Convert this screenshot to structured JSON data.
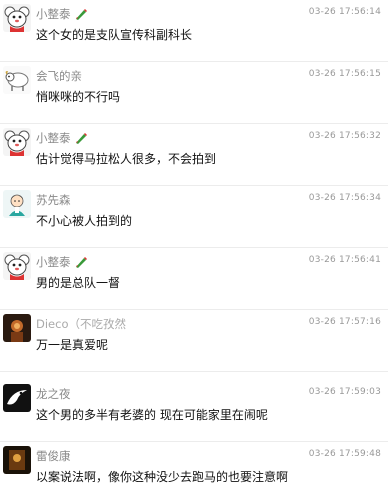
{
  "comments": [
    {
      "user": "小整泰",
      "time": "03-26 17:56:14",
      "text": "这个女的是支队宣传科副科长",
      "avatar": "cartoon-mouse",
      "badge": "pencil-icon"
    },
    {
      "user": "会飞的亲",
      "time": "03-26 17:56:15",
      "text": "悄咪咪的不行吗",
      "avatar": "cartoon-sheep"
    },
    {
      "user": "小整泰",
      "time": "03-26 17:56:32",
      "text": "估计觉得马拉松人很多，不会拍到",
      "avatar": "cartoon-mouse",
      "badge": "pencil-icon"
    },
    {
      "user": "苏先森",
      "time": "03-26 17:56:34",
      "text": "不小心被人拍到的",
      "avatar": "cartoon-boy"
    },
    {
      "user": "小整泰",
      "time": "03-26 17:56:41",
      "text": "男的是总队一督",
      "avatar": "cartoon-mouse",
      "badge": "pencil-icon"
    },
    {
      "user": "Dieco（不吃孜然",
      "time": "03-26 17:57:16",
      "text": "万一是真爱呢",
      "avatar": "dark-photo"
    },
    {
      "user": "龙之夜",
      "time": "03-26 17:59:03",
      "text": "这个男的多半有老婆的 现在可能家里在闹呢",
      "avatar": "black-white-logo"
    },
    {
      "user": "雷俊康",
      "time": "03-26 17:59:48",
      "text": "以案说法啊，像你这种没少去跑马的也要注意啊",
      "avatar": "dark-photo-2"
    }
  ]
}
